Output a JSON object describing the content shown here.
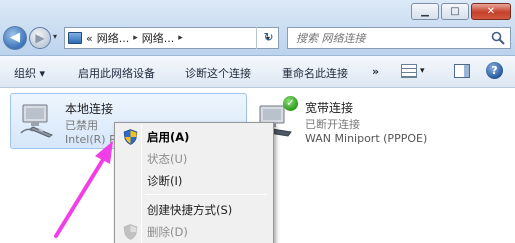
{
  "window": {
    "minimize_glyph": "▁",
    "maximize_glyph": "□",
    "close_glyph": "✕"
  },
  "nav": {
    "back_glyph": "◀",
    "forward_glyph": "▶",
    "dropdown_glyph": "▾"
  },
  "address": {
    "prefix": "«",
    "crumb1": "网络...",
    "crumb2": "网络...",
    "separator": "▸",
    "dropdown_glyph": "▾",
    "refresh_glyph": "↻"
  },
  "search": {
    "placeholder": "搜索 网络连接"
  },
  "toolbar": {
    "organize": "组织 ▾",
    "disable_device": "启用此网络设备",
    "diagnose": "诊断这个连接",
    "rename": "重命名此连接",
    "more": "»",
    "view_dropdown": "▾",
    "help": "?"
  },
  "connections": [
    {
      "name": "本地连接",
      "status": "已禁用",
      "device": "Intel(R) P"
    },
    {
      "name": "宽带连接",
      "status": "已断开连接",
      "device": "WAN Miniport (PPPOE)",
      "badge": "✓"
    }
  ],
  "context_menu": {
    "items": [
      {
        "label": "启用(A)",
        "style": "bold",
        "icon": "shield-icon"
      },
      {
        "label": "状态(U)",
        "style": "disabled"
      },
      {
        "label": "诊断(I)",
        "style": "normal"
      },
      {
        "label": "创建快捷方式(S)",
        "style": "normal"
      },
      {
        "label": "删除(D)",
        "style": "disabled",
        "icon": "shield-icon"
      }
    ]
  },
  "colors": {
    "annotation_arrow": "#f23ee8",
    "selection": "#d6e7fa",
    "shield_blue": "#2d6bc4",
    "shield_yellow": "#f2c21a"
  }
}
